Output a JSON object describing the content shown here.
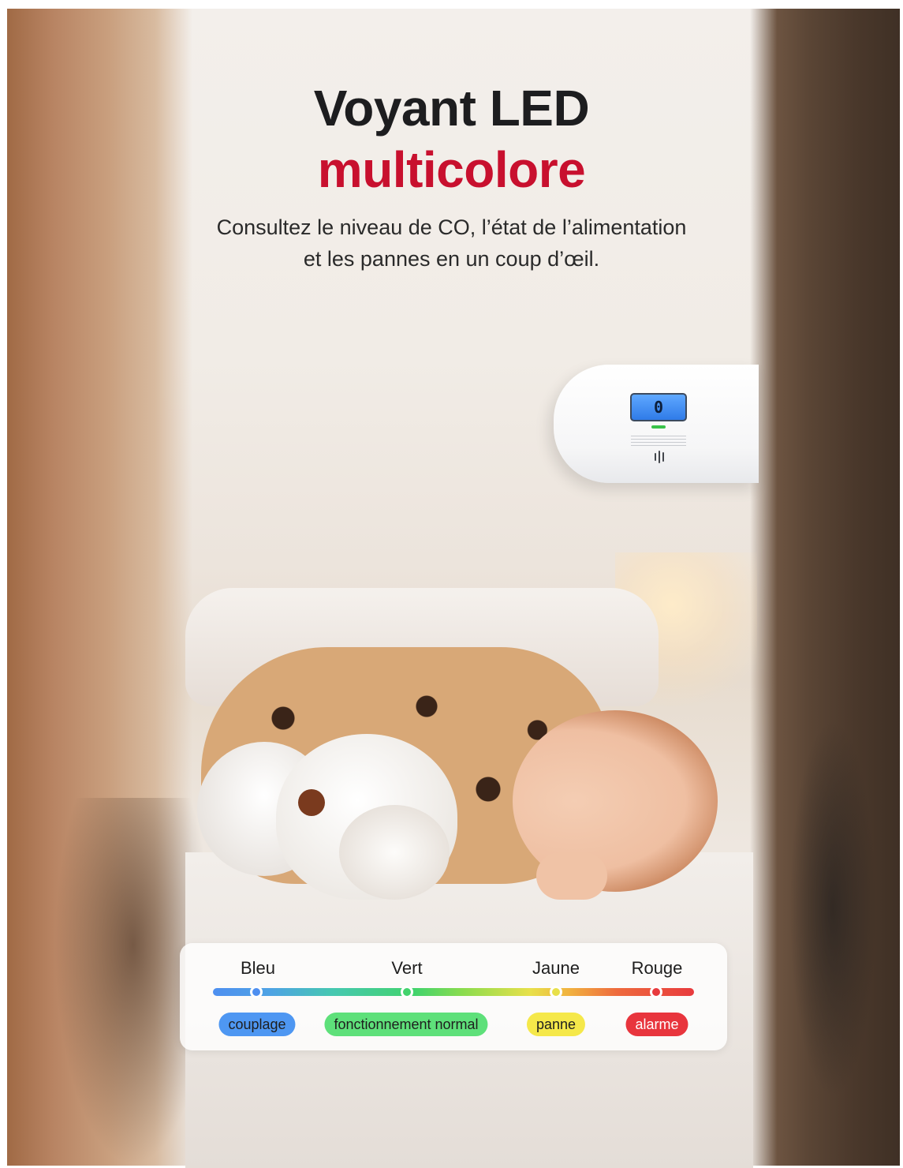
{
  "headline": {
    "line1": "Voyant LED",
    "line2": "multicolore",
    "line2_color": "#c8102e"
  },
  "subtitle": {
    "line1": "Consultez le niveau de CO, l’état de l’alimentation",
    "line2": "et les pannes en un coup d’œil."
  },
  "device": {
    "screen_reading": "0"
  },
  "legend": {
    "items": [
      {
        "label": "Bleu",
        "status": "couplage",
        "color": "#4e8ff0"
      },
      {
        "label": "Vert",
        "status": "fonctionnement normal",
        "color": "#42d36c"
      },
      {
        "label": "Jaune",
        "status": "panne",
        "color": "#f2e04a"
      },
      {
        "label": "Rouge",
        "status": "alarme",
        "color": "#e83a3d"
      }
    ]
  }
}
